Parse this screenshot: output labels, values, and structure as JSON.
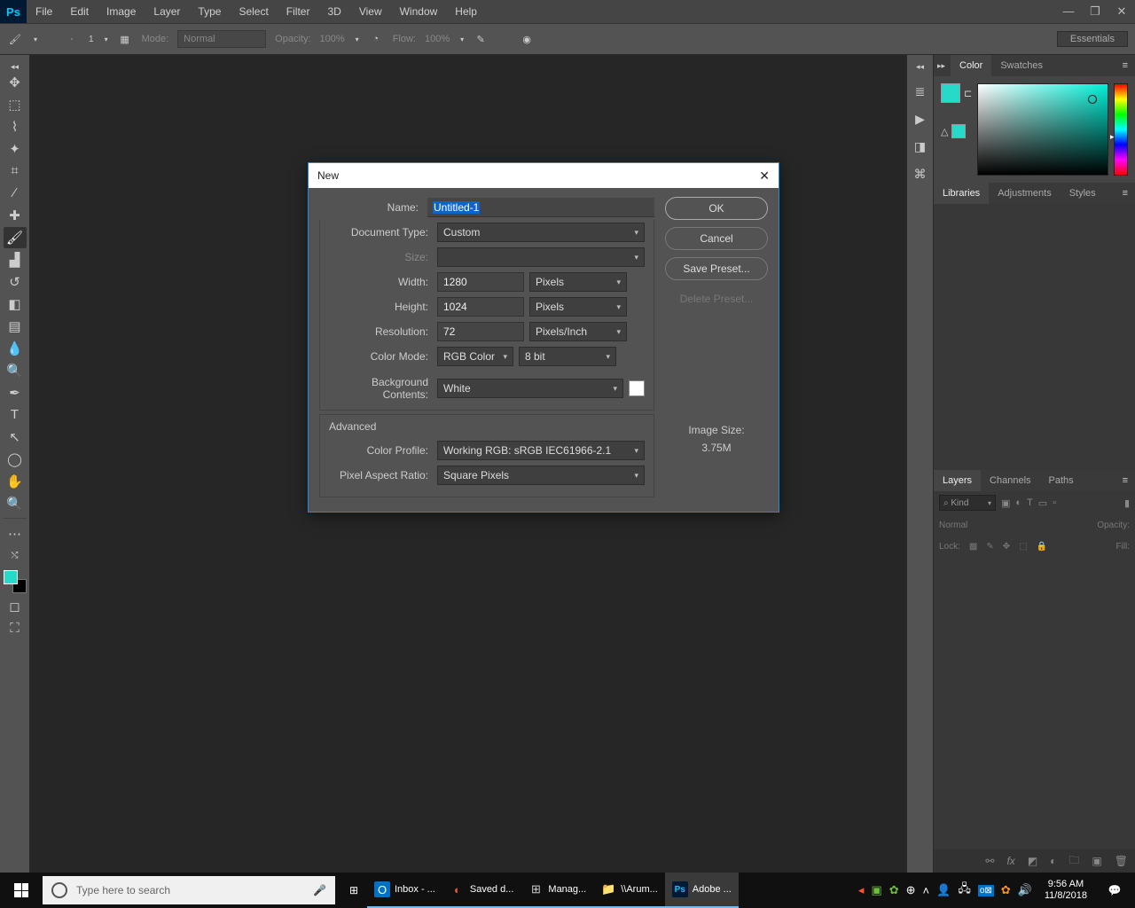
{
  "app": {
    "logo": "Ps"
  },
  "menu": [
    "File",
    "Edit",
    "Image",
    "Layer",
    "Type",
    "Select",
    "Filter",
    "3D",
    "View",
    "Window",
    "Help"
  ],
  "options": {
    "mode_label": "Mode:",
    "mode_value": "Normal",
    "opacity_label": "Opacity:",
    "opacity_value": "100%",
    "flow_label": "Flow:",
    "flow_value": "100%",
    "workspace": "Essentials",
    "brush_size": "1"
  },
  "panels": {
    "color": {
      "tabs": [
        "Color",
        "Swatches"
      ],
      "active": 0
    },
    "libs": {
      "tabs": [
        "Libraries",
        "Adjustments",
        "Styles"
      ],
      "active": 0
    },
    "layers": {
      "tabs": [
        "Layers",
        "Channels",
        "Paths"
      ],
      "active": 0,
      "filter": "Kind",
      "blend": "Normal",
      "op_label": "Opacity:",
      "lock_label": "Lock:",
      "fill_label": "Fill:",
      "search_ico": "⌕"
    }
  },
  "dialog": {
    "title": "New",
    "name_label": "Name:",
    "name_value": "Untitled-1",
    "doctype_label": "Document Type:",
    "doctype_value": "Custom",
    "size_label": "Size:",
    "width_label": "Width:",
    "width_value": "1280",
    "width_unit": "Pixels",
    "height_label": "Height:",
    "height_value": "1024",
    "height_unit": "Pixels",
    "res_label": "Resolution:",
    "res_value": "72",
    "res_unit": "Pixels/Inch",
    "colormode_label": "Color Mode:",
    "colormode_value": "RGB Color",
    "colordepth_value": "8 bit",
    "bg_label": "Background Contents:",
    "bg_value": "White",
    "advanced_label": "Advanced",
    "profile_label": "Color Profile:",
    "profile_value": "Working RGB:  sRGB IEC61966-2.1",
    "par_label": "Pixel Aspect Ratio:",
    "par_value": "Square Pixels",
    "btn_ok": "OK",
    "btn_cancel": "Cancel",
    "btn_save": "Save Preset...",
    "btn_delete": "Delete Preset...",
    "imgsize_label": "Image Size:",
    "imgsize_value": "3.75M"
  },
  "taskbar": {
    "search_placeholder": "Type here to search",
    "apps": [
      {
        "label": "Inbox - ...",
        "color": "#0072c6",
        "txt": "O"
      },
      {
        "label": "Saved d...",
        "color": "#e05a2b",
        "txt": "◐"
      },
      {
        "label": "Manag...",
        "color": "#444",
        "txt": "⊞"
      },
      {
        "label": "\\\\Arum...",
        "color": "#f5c147",
        "txt": "📁"
      },
      {
        "label": "Adobe ...",
        "color": "#001a33",
        "txt": "Ps"
      }
    ],
    "time": "9:56 AM",
    "date": "11/8/2018"
  }
}
